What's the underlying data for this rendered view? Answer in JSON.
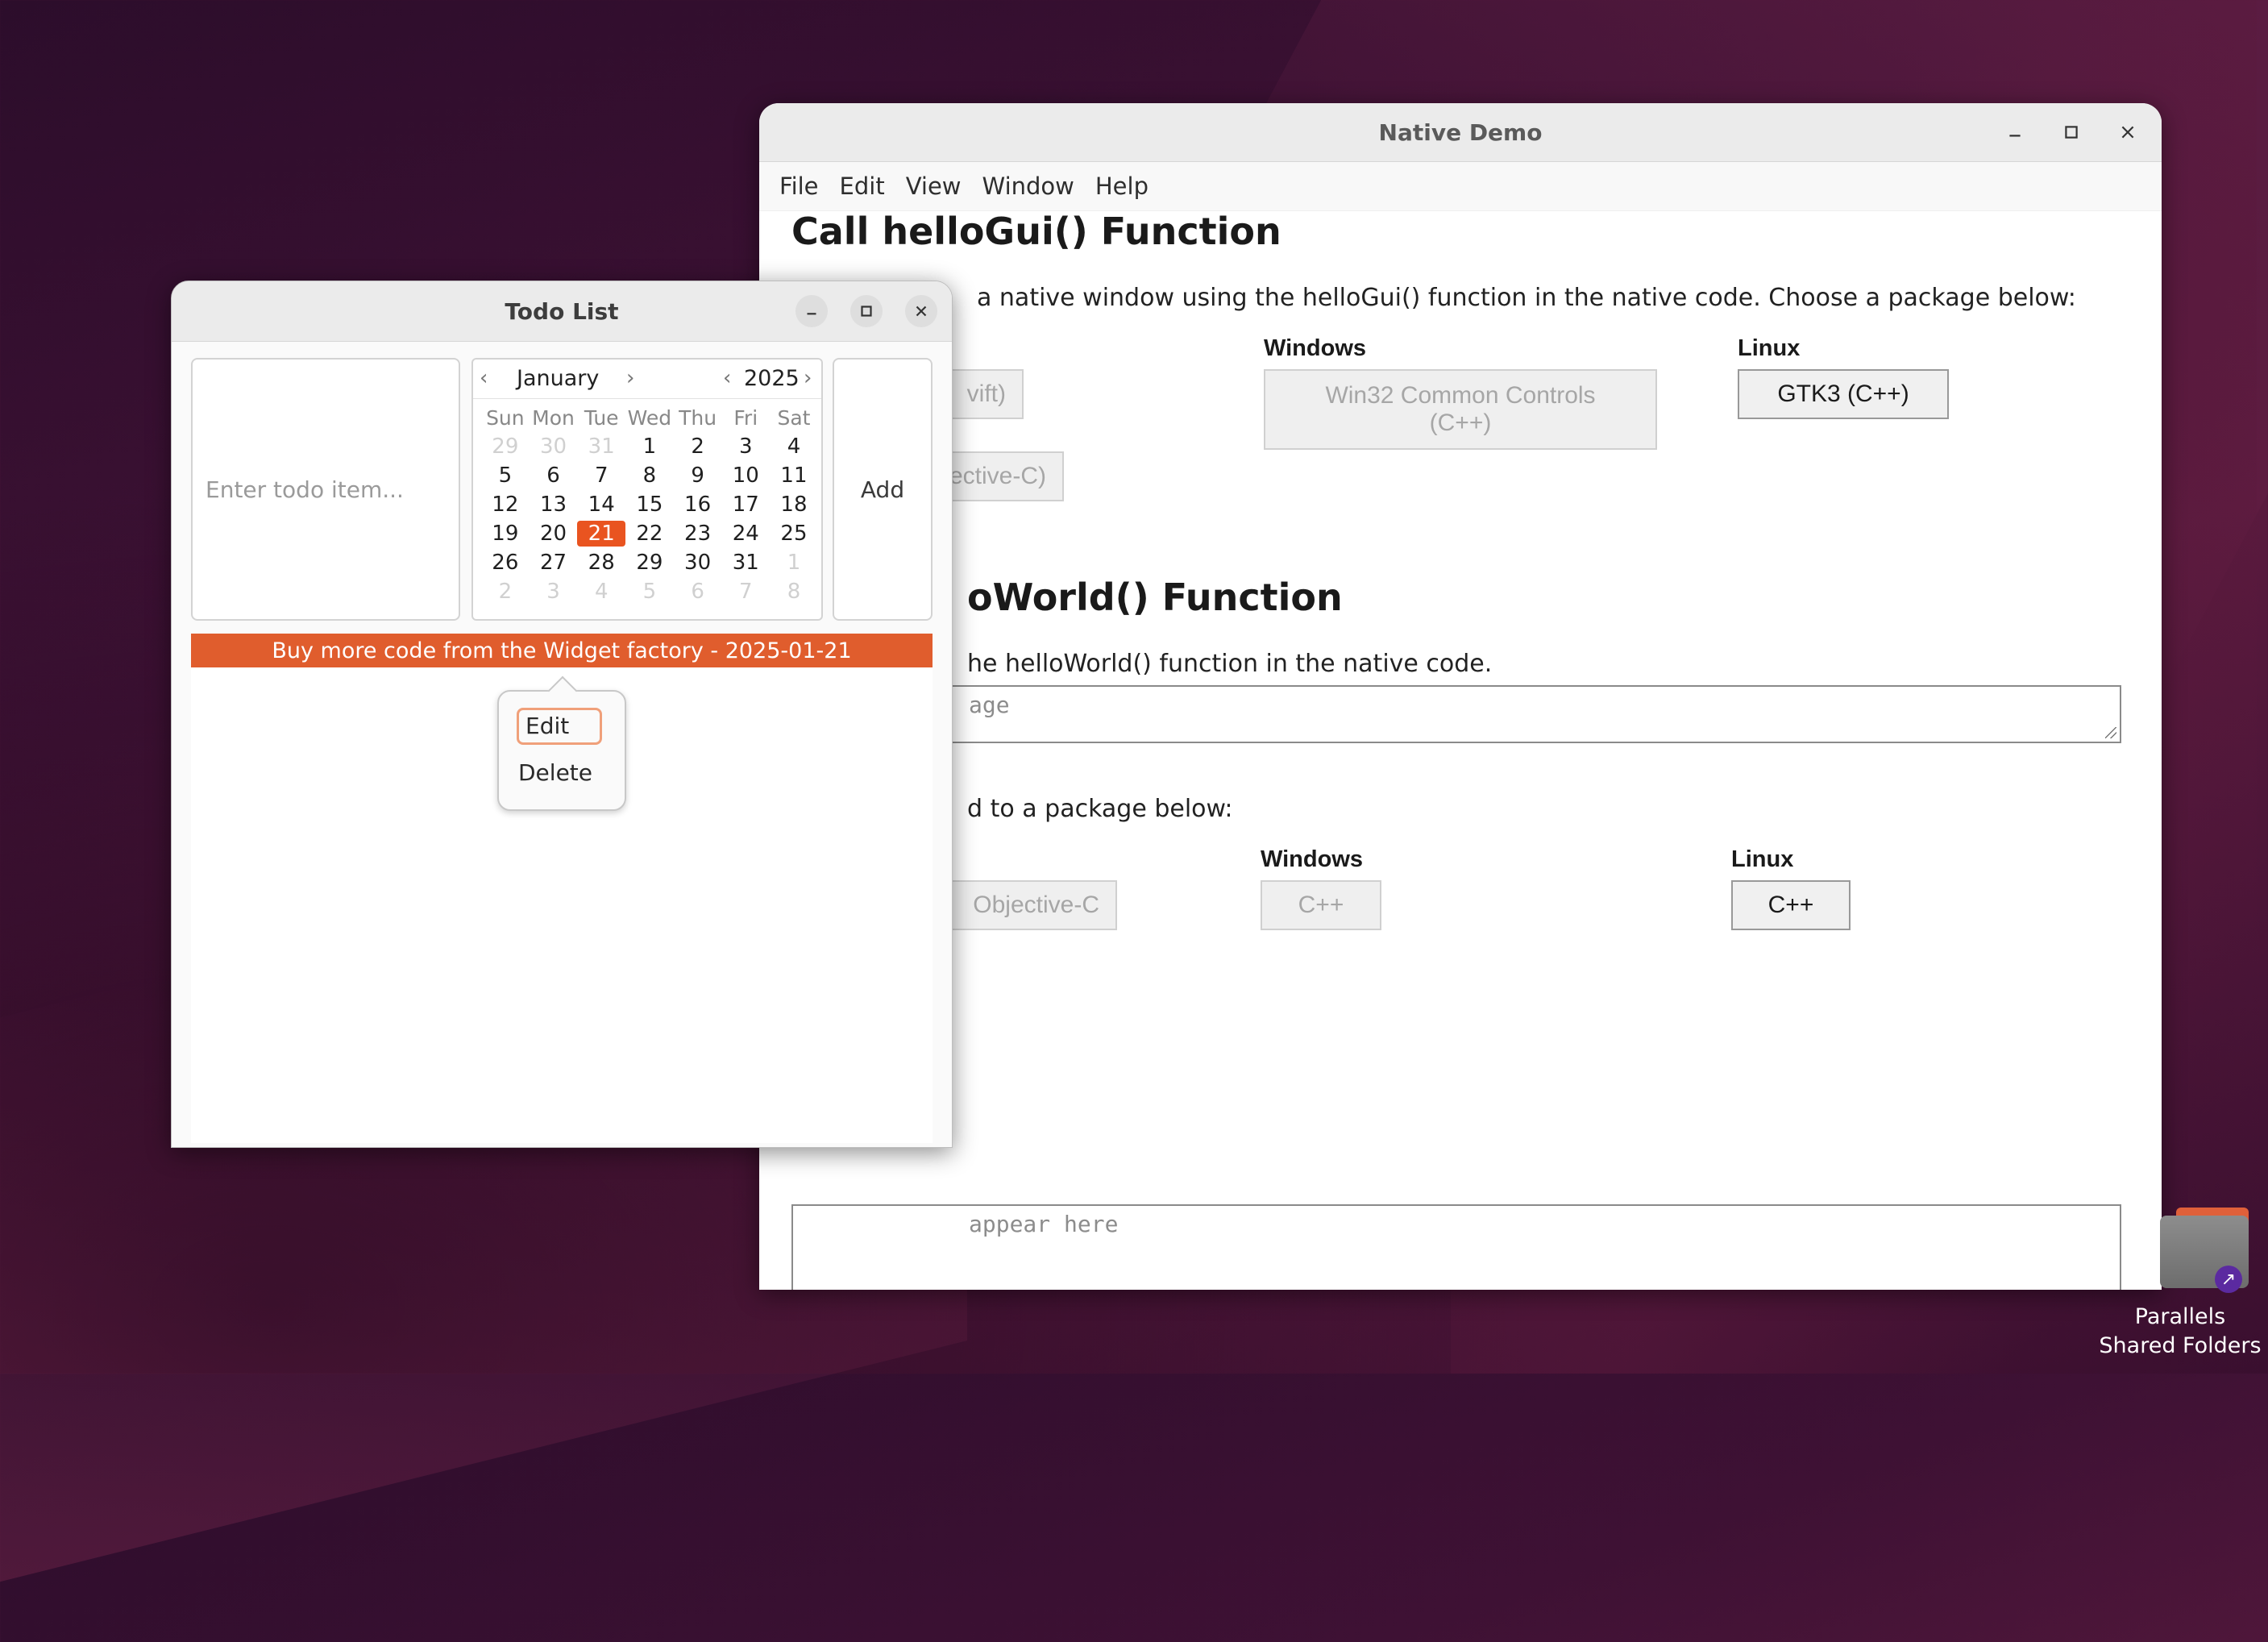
{
  "native_window": {
    "title": "Native Demo",
    "menu": [
      "File",
      "Edit",
      "View",
      "Window",
      "Help"
    ],
    "section1": {
      "heading": "Call helloGui() Function",
      "description": "a native window using the helloGui() function in the native code. Choose a package below:",
      "windows_label": "Windows",
      "linux_label": "Linux",
      "btn_mac_swift": "vift)",
      "btn_mac_objc": "jective-C)",
      "btn_win32": "Win32 Common Controls (C++)",
      "btn_gtk3": "GTK3 (C++)"
    },
    "section2": {
      "heading": "oWorld() Function",
      "description": "he helloWorld() function in the native code.",
      "message_placeholder": "age",
      "send_text": "d to a package below:",
      "windows_label": "Windows",
      "linux_label": "Linux",
      "btn_mac_objc": "Objective-C",
      "btn_win_cpp": "C++",
      "btn_linux_cpp": "C++"
    },
    "output_placeholder": "appear here"
  },
  "todo_window": {
    "title": "Todo List",
    "entry_placeholder": "Enter todo item...",
    "add_label": "Add",
    "calendar": {
      "month": "January",
      "year": "2025",
      "days_of_week": [
        "Sun",
        "Mon",
        "Tue",
        "Wed",
        "Thu",
        "Fri",
        "Sat"
      ],
      "weeks": [
        [
          "29",
          "30",
          "31",
          "1",
          "2",
          "3",
          "4"
        ],
        [
          "5",
          "6",
          "7",
          "8",
          "9",
          "10",
          "11"
        ],
        [
          "12",
          "13",
          "14",
          "15",
          "16",
          "17",
          "18"
        ],
        [
          "19",
          "20",
          "21",
          "22",
          "23",
          "24",
          "25"
        ],
        [
          "26",
          "27",
          "28",
          "29",
          "30",
          "31",
          "1"
        ],
        [
          "2",
          "3",
          "4",
          "5",
          "6",
          "7",
          "8"
        ]
      ],
      "selected_day": "21"
    },
    "items": [
      "Buy more code from the Widget factory - 2025-01-21"
    ],
    "context_menu": {
      "edit_label": "Edit",
      "delete_label": "Delete"
    }
  },
  "desktop": {
    "shared_folders_label": "Parallels Shared Folders"
  },
  "colors": {
    "accent": "#e95420",
    "todo_item_bg": "#e05d2d"
  }
}
